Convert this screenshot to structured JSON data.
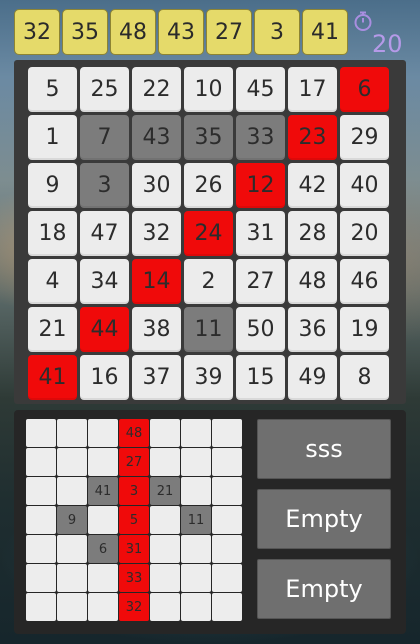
{
  "drawn_numbers": [
    "32",
    "35",
    "48",
    "43",
    "27",
    "3",
    "41"
  ],
  "timer": {
    "icon": "timer-icon",
    "value": "20"
  },
  "board": {
    "rows": [
      [
        {
          "n": "5",
          "s": "normal"
        },
        {
          "n": "25",
          "s": "normal"
        },
        {
          "n": "22",
          "s": "normal"
        },
        {
          "n": "10",
          "s": "normal"
        },
        {
          "n": "45",
          "s": "normal"
        },
        {
          "n": "17",
          "s": "normal"
        },
        {
          "n": "6",
          "s": "hit"
        }
      ],
      [
        {
          "n": "1",
          "s": "normal"
        },
        {
          "n": "7",
          "s": "marked"
        },
        {
          "n": "43",
          "s": "marked"
        },
        {
          "n": "35",
          "s": "marked"
        },
        {
          "n": "33",
          "s": "marked"
        },
        {
          "n": "23",
          "s": "hit"
        },
        {
          "n": "29",
          "s": "normal"
        }
      ],
      [
        {
          "n": "9",
          "s": "normal"
        },
        {
          "n": "3",
          "s": "marked"
        },
        {
          "n": "30",
          "s": "normal"
        },
        {
          "n": "26",
          "s": "normal"
        },
        {
          "n": "12",
          "s": "hit"
        },
        {
          "n": "42",
          "s": "normal"
        },
        {
          "n": "40",
          "s": "normal"
        }
      ],
      [
        {
          "n": "18",
          "s": "normal"
        },
        {
          "n": "47",
          "s": "normal"
        },
        {
          "n": "32",
          "s": "normal"
        },
        {
          "n": "24",
          "s": "hit"
        },
        {
          "n": "31",
          "s": "normal"
        },
        {
          "n": "28",
          "s": "normal"
        },
        {
          "n": "20",
          "s": "normal"
        }
      ],
      [
        {
          "n": "4",
          "s": "normal"
        },
        {
          "n": "34",
          "s": "normal"
        },
        {
          "n": "14",
          "s": "hit"
        },
        {
          "n": "2",
          "s": "normal"
        },
        {
          "n": "27",
          "s": "normal"
        },
        {
          "n": "48",
          "s": "normal"
        },
        {
          "n": "46",
          "s": "normal"
        }
      ],
      [
        {
          "n": "21",
          "s": "normal"
        },
        {
          "n": "44",
          "s": "hit"
        },
        {
          "n": "38",
          "s": "normal"
        },
        {
          "n": "11",
          "s": "marked"
        },
        {
          "n": "50",
          "s": "normal"
        },
        {
          "n": "36",
          "s": "normal"
        },
        {
          "n": "19",
          "s": "normal"
        }
      ],
      [
        {
          "n": "41",
          "s": "hit"
        },
        {
          "n": "16",
          "s": "normal"
        },
        {
          "n": "37",
          "s": "normal"
        },
        {
          "n": "39",
          "s": "normal"
        },
        {
          "n": "15",
          "s": "normal"
        },
        {
          "n": "49",
          "s": "normal"
        },
        {
          "n": "8",
          "s": "normal"
        }
      ]
    ]
  },
  "pattern_preview": {
    "rows": [
      [
        {
          "n": "",
          "s": "normal"
        },
        {
          "n": "",
          "s": "normal"
        },
        {
          "n": "",
          "s": "normal"
        },
        {
          "n": "48",
          "s": "hit"
        },
        {
          "n": "",
          "s": "normal"
        },
        {
          "n": "",
          "s": "normal"
        },
        {
          "n": "",
          "s": "normal"
        }
      ],
      [
        {
          "n": "",
          "s": "normal"
        },
        {
          "n": "",
          "s": "normal"
        },
        {
          "n": "",
          "s": "normal"
        },
        {
          "n": "27",
          "s": "hit"
        },
        {
          "n": "",
          "s": "normal"
        },
        {
          "n": "",
          "s": "normal"
        },
        {
          "n": "",
          "s": "normal"
        }
      ],
      [
        {
          "n": "",
          "s": "normal"
        },
        {
          "n": "",
          "s": "normal"
        },
        {
          "n": "41",
          "s": "marked"
        },
        {
          "n": "3",
          "s": "hit"
        },
        {
          "n": "21",
          "s": "marked"
        },
        {
          "n": "",
          "s": "normal"
        },
        {
          "n": "",
          "s": "normal"
        }
      ],
      [
        {
          "n": "",
          "s": "normal"
        },
        {
          "n": "9",
          "s": "marked"
        },
        {
          "n": "",
          "s": "normal"
        },
        {
          "n": "5",
          "s": "hit"
        },
        {
          "n": "",
          "s": "normal"
        },
        {
          "n": "11",
          "s": "marked"
        },
        {
          "n": "",
          "s": "normal"
        }
      ],
      [
        {
          "n": "",
          "s": "normal"
        },
        {
          "n": "",
          "s": "normal"
        },
        {
          "n": "6",
          "s": "marked"
        },
        {
          "n": "31",
          "s": "hit"
        },
        {
          "n": "",
          "s": "normal"
        },
        {
          "n": "",
          "s": "normal"
        },
        {
          "n": "",
          "s": "normal"
        }
      ],
      [
        {
          "n": "",
          "s": "normal"
        },
        {
          "n": "",
          "s": "normal"
        },
        {
          "n": "",
          "s": "normal"
        },
        {
          "n": "33",
          "s": "hit"
        },
        {
          "n": "",
          "s": "normal"
        },
        {
          "n": "",
          "s": "normal"
        },
        {
          "n": "",
          "s": "normal"
        }
      ],
      [
        {
          "n": "",
          "s": "normal"
        },
        {
          "n": "",
          "s": "normal"
        },
        {
          "n": "",
          "s": "normal"
        },
        {
          "n": "32",
          "s": "hit"
        },
        {
          "n": "",
          "s": "normal"
        },
        {
          "n": "",
          "s": "normal"
        },
        {
          "n": "",
          "s": "normal"
        }
      ]
    ]
  },
  "slots": [
    "sss",
    "Empty",
    "Empty"
  ],
  "colors": {
    "draw_chip": "#e5da6a",
    "hit": "#f00a0a",
    "marked": "#7c7c7c",
    "cell": "#ececec",
    "timer": "#b59ae8"
  }
}
